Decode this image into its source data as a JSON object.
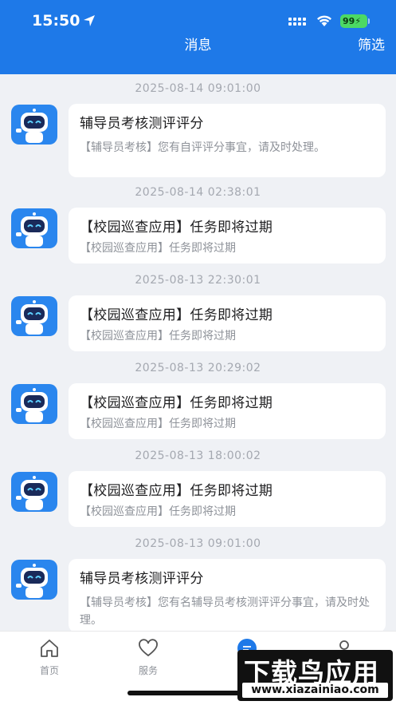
{
  "status_bar": {
    "time": "15:50",
    "battery": "99"
  },
  "header": {
    "title": "消息",
    "filter_label": "筛选"
  },
  "messages": [
    {
      "timestamp": "2025-08-14 09:01:00",
      "title": "辅导员考核测评评分",
      "body": "【辅导员考核】您有自评评分事宜，请及时处理。"
    },
    {
      "timestamp": "2025-08-14 02:38:01",
      "title": "【校园巡查应用】任务即将过期",
      "body": "【校园巡查应用】任务即将过期"
    },
    {
      "timestamp": "2025-08-13 22:30:01",
      "title": "【校园巡查应用】任务即将过期",
      "body": "【校园巡查应用】任务即将过期"
    },
    {
      "timestamp": "2025-08-13 20:29:02",
      "title": "【校园巡查应用】任务即将过期",
      "body": "【校园巡查应用】任务即将过期"
    },
    {
      "timestamp": "2025-08-13 18:00:02",
      "title": "【校园巡查应用】任务即将过期",
      "body": "【校园巡查应用】任务即将过期"
    },
    {
      "timestamp": "2025-08-13 09:01:00",
      "title": "辅导员考核测评评分",
      "body": "【辅导员考核】您有名辅导员考核测评评分事宜，请及时处理。"
    }
  ],
  "tabbar": {
    "tabs": [
      {
        "label": "首页",
        "icon": "home-icon"
      },
      {
        "label": "服务",
        "icon": "heart-icon"
      },
      {
        "label": "",
        "icon": "message-icon"
      },
      {
        "label": "",
        "icon": "user-icon"
      }
    ]
  },
  "watermark": {
    "line1": "下载鸟应用",
    "line2": "www.xiazainiao.com"
  }
}
